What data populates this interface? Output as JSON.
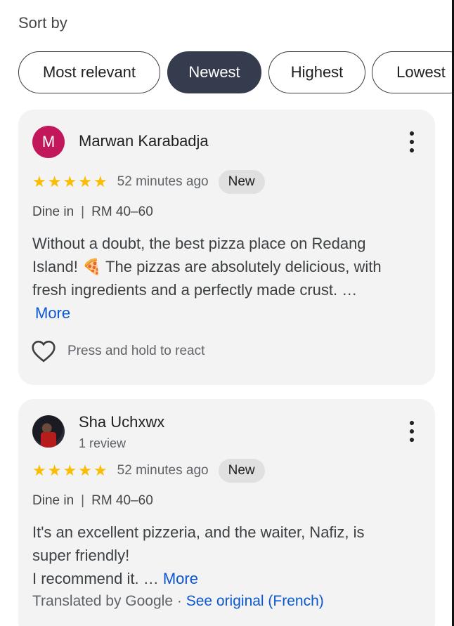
{
  "sort": {
    "label": "Sort by",
    "chips": [
      "Most relevant",
      "Newest",
      "Highest",
      "Lowest"
    ],
    "active": "Newest"
  },
  "reviews": [
    {
      "avatar_letter": "M",
      "avatar_color": "#c2185b",
      "name": "Marwan Karabadja",
      "rating": 5,
      "time": "52 minutes ago",
      "badge": "New",
      "service": "Dine in",
      "price": "RM 40–60",
      "text_line1": "Without a doubt, the best pizza place on Redang",
      "text_line2a": "Island! ",
      "emoji": "🍕",
      "text_line2b": " The pizzas are absolutely delicious, with",
      "text_line3": "fresh ingredients and a perfectly made crust. …",
      "more": "More",
      "react_label": "Press and hold to react"
    },
    {
      "name": "Sha Uchxwx",
      "subtitle": "1 review",
      "rating": 5,
      "time": "52 minutes ago",
      "badge": "New",
      "service": "Dine in",
      "price": "RM 40–60",
      "text_line1": "It's an excellent pizzeria, and the waiter, Nafiz, is",
      "text_line2": "super friendly!",
      "text_line3": "I recommend it. … ",
      "more": "More",
      "translated": "Translated by Google",
      "see_original": "See original (French)"
    }
  ],
  "colors": {
    "star": "#fbbc04",
    "link": "#0b57d0",
    "active_chip": "#353c4e"
  },
  "icons": [
    "star-icon",
    "more-vert-icon",
    "heart-outline-icon"
  ]
}
